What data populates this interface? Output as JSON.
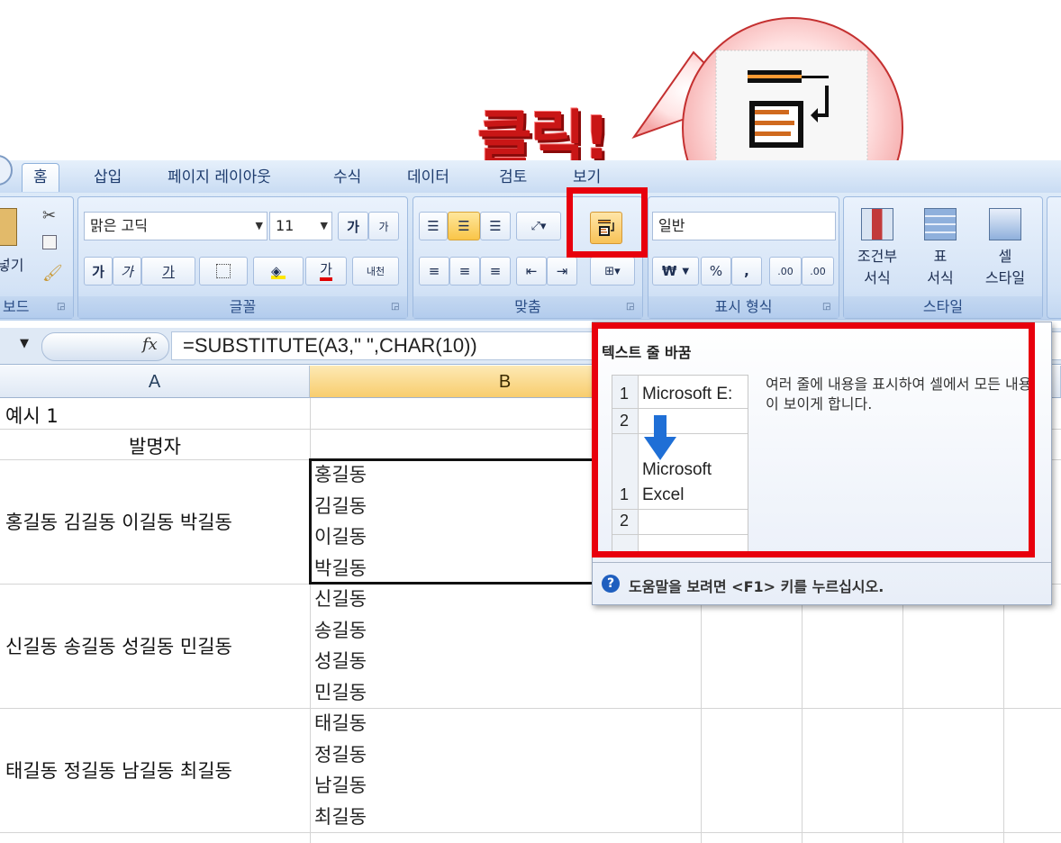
{
  "annotation": {
    "click_text": "클릭!"
  },
  "tabs": [
    {
      "label": "홈",
      "active": true
    },
    {
      "label": "삽입"
    },
    {
      "label": "페이지 레이아웃"
    },
    {
      "label": "수식"
    },
    {
      "label": "데이터"
    },
    {
      "label": "검토"
    },
    {
      "label": "보기"
    }
  ],
  "ribbon": {
    "clipboard": {
      "label": "보드",
      "paste_label": "넣기"
    },
    "font": {
      "label": "글꼴",
      "font_name": "맑은 고딕",
      "font_size": "11",
      "grow": "가",
      "shrink": "가",
      "bold": "가",
      "italic": "가",
      "underline": "가",
      "font_color": "가",
      "phonetic": "내천"
    },
    "alignment": {
      "label": "맞춤"
    },
    "number": {
      "label": "표시 형식",
      "format": "일반",
      "currency": "₩",
      "percent": "%",
      "comma": ",",
      "inc_decimal": ".00",
      "dec_decimal": ".00"
    },
    "styles": {
      "label": "스타일",
      "conditional": [
        "조건부",
        "서식"
      ],
      "table": [
        "표",
        "서식"
      ],
      "cell": [
        "셀",
        "스타일"
      ]
    }
  },
  "formula_bar": {
    "fx": "fx",
    "formula": "=SUBSTITUTE(A3,\" \",CHAR(10))"
  },
  "columns": [
    "A",
    "B"
  ],
  "cells": {
    "a1": "예시 1",
    "a2": "발명자",
    "a3": "홍길동 김길동 이길동 박길동",
    "a4": "신길동 송길동 성길동 민길동",
    "a5": "태길동 정길동 남길동 최길동",
    "b3": [
      "홍길동",
      "김길동",
      "이길동",
      "박길동"
    ],
    "b4": [
      "신길동",
      "송길동",
      "성길동",
      "민길동"
    ],
    "b5": [
      "태길동",
      "정길동",
      "남길동",
      "최길동"
    ]
  },
  "tooltip": {
    "title": "텍스트 줄 바꿈",
    "description": "여러 줄에 내용을 표시하여 셀에서 모든 내용이 보이게 합니다.",
    "preview_before": "Microsoft E:",
    "preview_after": [
      "Microsoft",
      "Excel"
    ],
    "rows": [
      "1",
      "2"
    ],
    "help": "도움말을 보려면 <F1> 키를 누르십시오."
  },
  "colors": {
    "highlight_red": "#e8000d",
    "ribbon_blue": "#c6d9f1",
    "arrow_blue": "#1f6fd6"
  }
}
